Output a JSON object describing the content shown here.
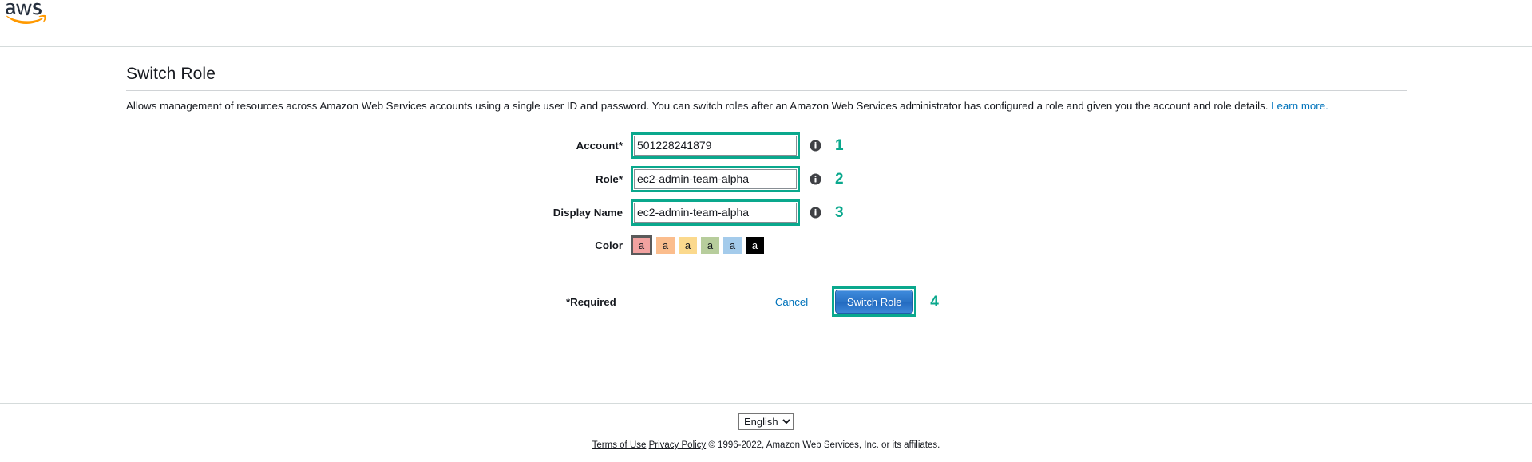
{
  "header": {
    "logo_alt": "aws"
  },
  "page": {
    "title": "Switch Role",
    "description_part1": "Allows management of resources across Amazon Web Services accounts using a single user ID and password. You can switch roles after an Amazon Web Services administrator has configured a role and given you the account and role details. ",
    "learn_more": "Learn more."
  },
  "form": {
    "fields": [
      {
        "label": "Account",
        "required_mark": "*",
        "value": "501228241879",
        "placeholder": "",
        "annotation": "1"
      },
      {
        "label": "Role",
        "required_mark": "*",
        "value": "ec2-admin-team-alpha",
        "placeholder": "",
        "annotation": "2"
      },
      {
        "label": "Display Name",
        "required_mark": "",
        "value": "ec2-admin-team-alpha",
        "placeholder": "",
        "annotation": "3"
      }
    ],
    "color": {
      "label": "Color",
      "swatch_glyph": "a",
      "selected_index": 0,
      "swatches": [
        {
          "name": "red",
          "hex": "#f2a2a0",
          "selected": true,
          "dark": false
        },
        {
          "name": "orange",
          "hex": "#fbbd8d",
          "selected": false,
          "dark": false
        },
        {
          "name": "yellow",
          "hex": "#fbd98d",
          "selected": false,
          "dark": false
        },
        {
          "name": "green",
          "hex": "#b7cd9c",
          "selected": false,
          "dark": false
        },
        {
          "name": "blue",
          "hex": "#a4cbeb",
          "selected": false,
          "dark": false
        },
        {
          "name": "black",
          "hex": "#000000",
          "selected": false,
          "dark": true
        }
      ]
    }
  },
  "actions": {
    "required_note": "*Required",
    "cancel_label": "Cancel",
    "submit_label": "Switch Role",
    "submit_annotation": "4"
  },
  "footer": {
    "language_selected": "English",
    "language_options": [
      "English"
    ],
    "terms_of_use": "Terms of Use",
    "privacy_policy": "Privacy Policy",
    "copyright": "© 1996-2022, Amazon Web Services, Inc. or its affiliates."
  },
  "colors": {
    "annotation_teal": "#0aa88d",
    "link_blue": "#0073bb",
    "button_blue": "#2a73c6",
    "aws_orange": "#ff9900",
    "aws_dark": "#252f3e"
  }
}
